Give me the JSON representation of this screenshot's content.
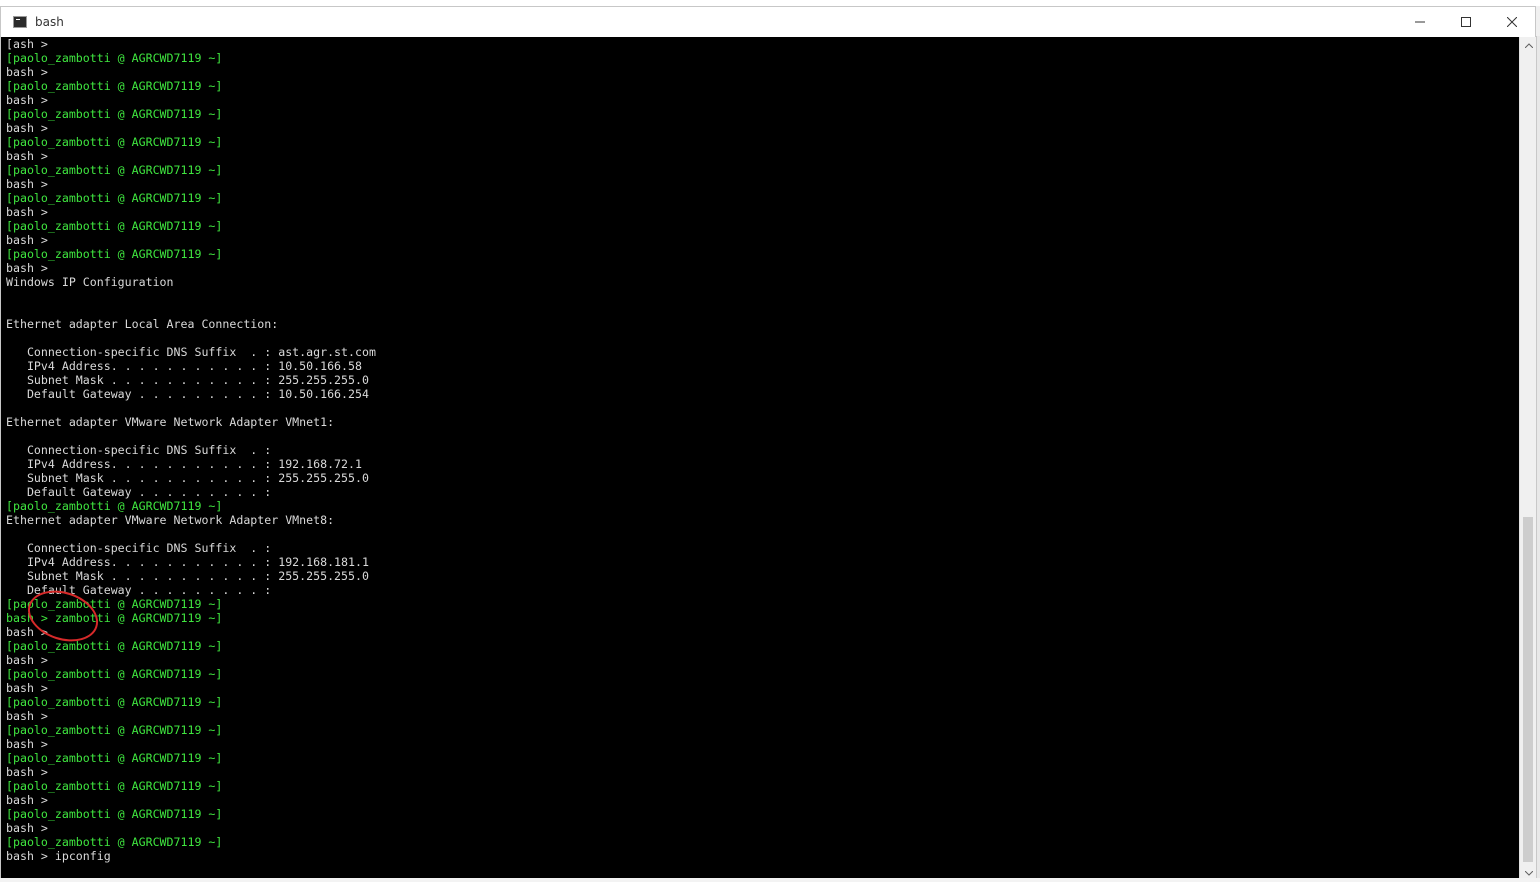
{
  "window": {
    "title": "bash",
    "controls": [
      "minimize",
      "maximize",
      "close"
    ]
  },
  "terminal": {
    "lines": [
      {
        "text": "[ash >",
        "kind": "bash"
      },
      {
        "text": "[paolo_zambotti @ AGRCWD7119 ~]",
        "kind": "prompt"
      },
      {
        "text": "bash >",
        "kind": "bash"
      },
      {
        "text": "[paolo_zambotti @ AGRCWD7119 ~]",
        "kind": "prompt"
      },
      {
        "text": "bash >",
        "kind": "bash"
      },
      {
        "text": "[paolo_zambotti @ AGRCWD7119 ~]",
        "kind": "prompt"
      },
      {
        "text": "bash >",
        "kind": "bash"
      },
      {
        "text": "[paolo_zambotti @ AGRCWD7119 ~]",
        "kind": "prompt"
      },
      {
        "text": "bash >",
        "kind": "bash"
      },
      {
        "text": "[paolo_zambotti @ AGRCWD7119 ~]",
        "kind": "prompt"
      },
      {
        "text": "bash >",
        "kind": "bash"
      },
      {
        "text": "[paolo_zambotti @ AGRCWD7119 ~]",
        "kind": "prompt"
      },
      {
        "text": "bash >",
        "kind": "bash"
      },
      {
        "text": "[paolo_zambotti @ AGRCWD7119 ~]",
        "kind": "prompt"
      },
      {
        "text": "bash >",
        "kind": "bash"
      },
      {
        "text": "[paolo_zambotti @ AGRCWD7119 ~]",
        "kind": "prompt"
      },
      {
        "text": "bash >",
        "kind": "bash"
      },
      {
        "text": "Windows IP Configuration",
        "kind": "out"
      },
      {
        "text": "",
        "kind": "out"
      },
      {
        "text": "",
        "kind": "out"
      },
      {
        "text": "Ethernet adapter Local Area Connection:",
        "kind": "out"
      },
      {
        "text": "",
        "kind": "out"
      },
      {
        "text": "   Connection-specific DNS Suffix  . : ast.agr.st.com",
        "kind": "out"
      },
      {
        "text": "   IPv4 Address. . . . . . . . . . . : 10.50.166.58",
        "kind": "out"
      },
      {
        "text": "   Subnet Mask . . . . . . . . . . . : 255.255.255.0",
        "kind": "out"
      },
      {
        "text": "   Default Gateway . . . . . . . . . : 10.50.166.254",
        "kind": "out"
      },
      {
        "text": "",
        "kind": "out"
      },
      {
        "text": "Ethernet adapter VMware Network Adapter VMnet1:",
        "kind": "out"
      },
      {
        "text": "",
        "kind": "out"
      },
      {
        "text": "   Connection-specific DNS Suffix  . :",
        "kind": "out"
      },
      {
        "text": "   IPv4 Address. . . . . . . . . . . : 192.168.72.1",
        "kind": "out"
      },
      {
        "text": "   Subnet Mask . . . . . . . . . . . : 255.255.255.0",
        "kind": "out"
      },
      {
        "text": "   Default Gateway . . . . . . . . . :",
        "kind": "out"
      },
      {
        "text": "[paolo_zambotti @ AGRCWD7119 ~]",
        "kind": "prompt"
      },
      {
        "text": "Ethernet adapter VMware Network Adapter VMnet8:",
        "kind": "out"
      },
      {
        "text": "",
        "kind": "out"
      },
      {
        "text": "   Connection-specific DNS Suffix  . :",
        "kind": "out"
      },
      {
        "text": "   IPv4 Address. . . . . . . . . . . : 192.168.181.1",
        "kind": "out"
      },
      {
        "text": "   Subnet Mask . . . . . . . . . . . : 255.255.255.0",
        "kind": "out"
      },
      {
        "text": "   Default Gateway . . . . . . . . . :",
        "kind": "out"
      },
      {
        "text": "[paolo_zambotti @ AGRCWD7119 ~]",
        "kind": "prompt"
      },
      {
        "text": "bash > zambotti @ AGRCWD7119 ~]",
        "kind": "prompt"
      },
      {
        "text": "bash >",
        "kind": "bash"
      },
      {
        "text": "[paolo_zambotti @ AGRCWD7119 ~]",
        "kind": "prompt"
      },
      {
        "text": "bash >",
        "kind": "bash"
      },
      {
        "text": "[paolo_zambotti @ AGRCWD7119 ~]",
        "kind": "prompt"
      },
      {
        "text": "bash >",
        "kind": "bash"
      },
      {
        "text": "[paolo_zambotti @ AGRCWD7119 ~]",
        "kind": "prompt"
      },
      {
        "text": "bash >",
        "kind": "bash"
      },
      {
        "text": "[paolo_zambotti @ AGRCWD7119 ~]",
        "kind": "prompt"
      },
      {
        "text": "bash >",
        "kind": "bash"
      },
      {
        "text": "[paolo_zambotti @ AGRCWD7119 ~]",
        "kind": "prompt"
      },
      {
        "text": "bash >",
        "kind": "bash"
      },
      {
        "text": "[paolo_zambotti @ AGRCWD7119 ~]",
        "kind": "prompt"
      },
      {
        "text": "bash >",
        "kind": "bash"
      },
      {
        "text": "[paolo_zambotti @ AGRCWD7119 ~]",
        "kind": "prompt"
      },
      {
        "text": "bash >",
        "kind": "bash"
      },
      {
        "text": "[paolo_zambotti @ AGRCWD7119 ~]",
        "kind": "prompt"
      },
      {
        "text": "bash > ipconfig",
        "kind": "bash"
      }
    ]
  },
  "colors": {
    "prompt": "#3fe63f",
    "text": "#d9d9d9",
    "background": "#000000",
    "annotation": "#d62a2a"
  },
  "icons": {
    "app": "terminal-icon",
    "minimize": "minimize-icon",
    "maximize": "maximize-icon",
    "close": "close-icon",
    "scroll_up": "chevron-up-icon",
    "scroll_down": "chevron-down-icon"
  }
}
